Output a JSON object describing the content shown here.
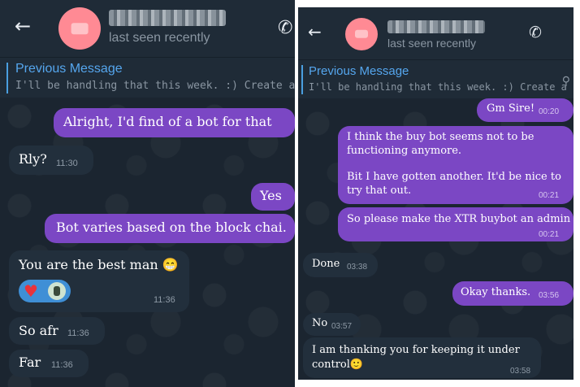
{
  "left": {
    "back_icon": "arrow-left-icon",
    "status": "last seen recently",
    "phone_icon": "phone-icon",
    "pinned_title": "Previous Message",
    "pinned_text": "I'll be handling that this week. :) Create a pre b",
    "messages": [
      {
        "text": "Alright, I'd find of a bot for that",
        "time": "",
        "direction": "out"
      },
      {
        "text": "Rly?",
        "time": "11:30",
        "direction": "in"
      },
      {
        "text": "Yes",
        "time": "",
        "direction": "out"
      },
      {
        "text": "Bot varies based on the block chai.",
        "time": "",
        "direction": "out"
      },
      {
        "text": "You are the best man 😁",
        "time": "11:36",
        "direction": "in",
        "reactions": [
          "heart-icon",
          "user-avatar"
        ]
      },
      {
        "text": "So afr",
        "time": "11:36",
        "direction": "in"
      },
      {
        "text": "Far",
        "time": "11:36",
        "direction": "in"
      }
    ]
  },
  "right": {
    "back_icon": "arrow-left-icon",
    "status": "last seen recently",
    "phone_icon": "phone-icon",
    "pinned_title": "Previous Message",
    "pinned_text": "I'll be handling that this week. :) Create a pre b",
    "pin_icon": "pin-icon",
    "messages": [
      {
        "text": "Gm Sire!",
        "time": "00:20",
        "direction": "out"
      },
      {
        "line1": "I think the buy bot seems not to be",
        "line2": "functioning anymore.",
        "line3": "Bit I have gotten another. It'd be nice to",
        "line4": "try that out.",
        "time": "00:21",
        "direction": "out"
      },
      {
        "text": "So please make the XTR buybot an admin",
        "time": "00:21",
        "direction": "out"
      },
      {
        "text": "Done",
        "time": "03:38",
        "direction": "in"
      },
      {
        "text": "Okay thanks.",
        "time": "03:56",
        "direction": "out"
      },
      {
        "text": "No",
        "time": "03:57",
        "direction": "in"
      },
      {
        "line1": "I am thanking you for keeping it under",
        "line2": "control🙂",
        "time": "03:58",
        "direction": "in"
      }
    ]
  }
}
